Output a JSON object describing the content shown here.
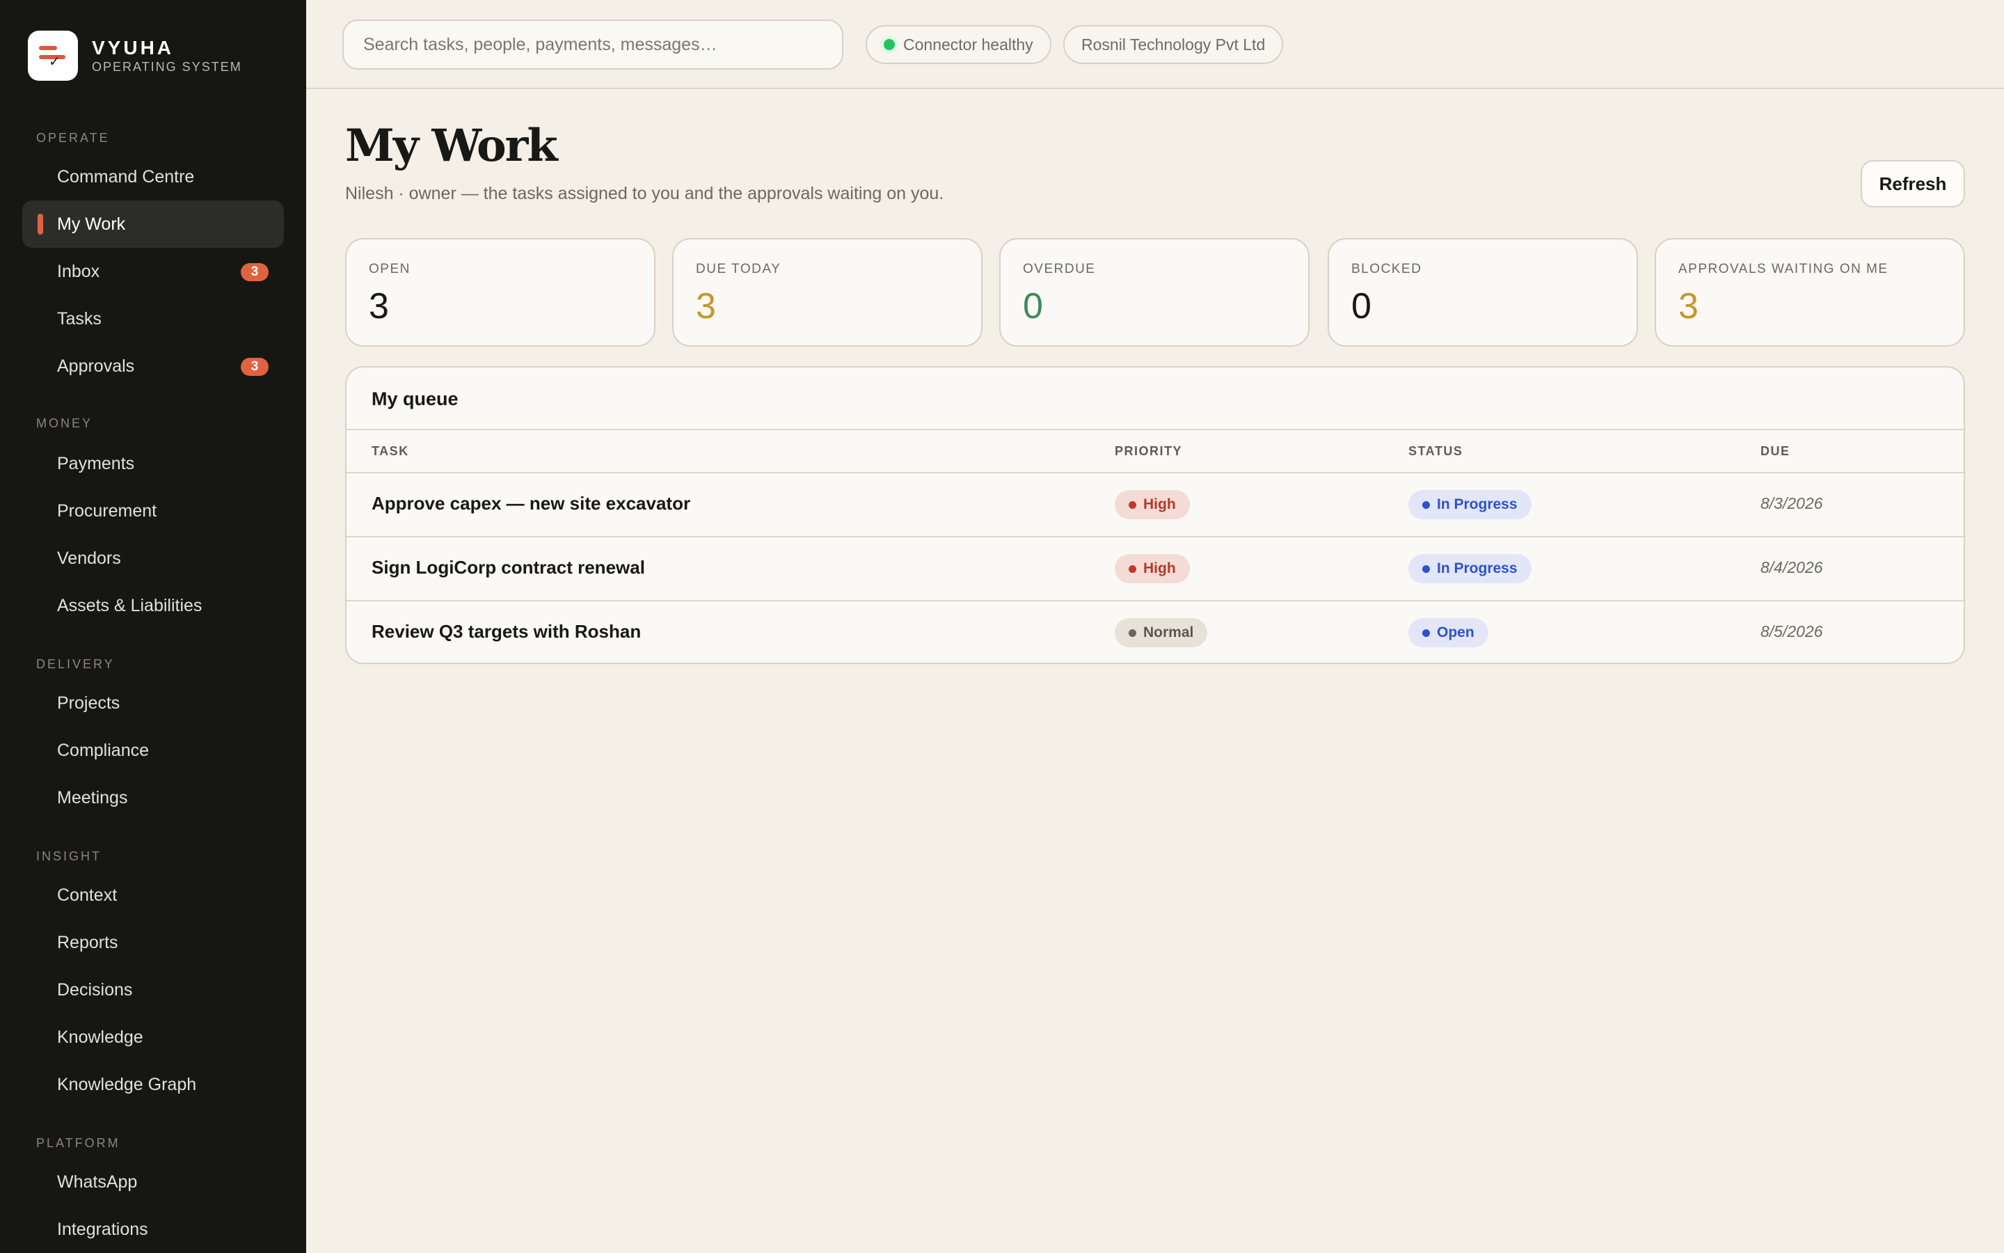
{
  "brand": {
    "name": "VYUHA",
    "subtitle": "OPERATING SYSTEM"
  },
  "sidebar": {
    "sections": [
      {
        "title": "OPERATE",
        "items": [
          {
            "label": "Command Centre"
          },
          {
            "label": "My Work",
            "active": true
          },
          {
            "label": "Inbox",
            "badge": "3"
          },
          {
            "label": "Tasks"
          },
          {
            "label": "Approvals",
            "badge": "3"
          }
        ]
      },
      {
        "title": "MONEY",
        "items": [
          {
            "label": "Payments"
          },
          {
            "label": "Procurement"
          },
          {
            "label": "Vendors"
          },
          {
            "label": "Assets & Liabilities"
          }
        ]
      },
      {
        "title": "DELIVERY",
        "items": [
          {
            "label": "Projects"
          },
          {
            "label": "Compliance"
          },
          {
            "label": "Meetings"
          }
        ]
      },
      {
        "title": "INSIGHT",
        "items": [
          {
            "label": "Context"
          },
          {
            "label": "Reports"
          },
          {
            "label": "Decisions"
          },
          {
            "label": "Knowledge"
          },
          {
            "label": "Knowledge Graph"
          }
        ]
      },
      {
        "title": "PLATFORM",
        "items": [
          {
            "label": "WhatsApp"
          },
          {
            "label": "Integrations"
          }
        ]
      }
    ]
  },
  "topbar": {
    "search_placeholder": "Search tasks, people, payments, messages…",
    "connector_status": "Connector healthy",
    "connector_color": "#22c55e",
    "company": "Rosnil Technology Pvt Ltd"
  },
  "header": {
    "title": "My Work",
    "subtitle": "Nilesh · owner — the tasks assigned to you and the approvals waiting on you.",
    "refresh_label": "Refresh"
  },
  "stats": [
    {
      "label": "OPEN",
      "value": "3",
      "color": "#181815"
    },
    {
      "label": "DUE TODAY",
      "value": "3",
      "color": "#c8962e"
    },
    {
      "label": "OVERDUE",
      "value": "0",
      "color": "#3d8a5a"
    },
    {
      "label": "BLOCKED",
      "value": "0",
      "color": "#181815"
    },
    {
      "label": "APPROVALS WAITING ON ME",
      "value": "3",
      "color": "#c8962e"
    }
  ],
  "queue": {
    "title": "My queue",
    "columns": [
      "TASK",
      "PRIORITY",
      "STATUS",
      "DUE"
    ],
    "rows": [
      {
        "task": "Approve capex — new site excavator",
        "priority": "High",
        "status": "In Progress",
        "due": "8/3/2026"
      },
      {
        "task": "Sign LogiCorp contract renewal",
        "priority": "High",
        "status": "In Progress",
        "due": "8/4/2026"
      },
      {
        "task": "Review Q3 targets with Roshan",
        "priority": "Normal",
        "status": "Open",
        "due": "8/5/2026"
      }
    ]
  }
}
